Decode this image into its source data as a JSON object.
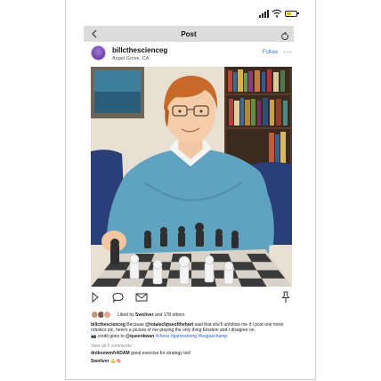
{
  "header": {
    "title": "Post"
  },
  "profile": {
    "username": "billcthescienceg",
    "location": "Angel Grove, CA",
    "follow_label": "Follow",
    "more_label": "···"
  },
  "photo": {
    "description_icon": "chess-player-photo"
  },
  "likes": {
    "prefix": "Liked by ",
    "user": "Swoliver",
    "suffix": " and 178 others"
  },
  "caption": {
    "author": "billcthescienceg",
    "part1": " Because ",
    "mention1": "@totaleclipseofthehart",
    "part2": " said that she'll unfollow me if I post one more robotics pic, here's a picture of me playing the only thing Einstein and I disagree on.",
    "camera": "📷",
    "part3": " credit goes to ",
    "mention2": "@queenkwan",
    "hashtags": " #chess #gamestrong #leaguechamp"
  },
  "view_all": "View all 2 comments",
  "comments": [
    {
      "user": "dntknowmfrADAM",
      "text": " great exercise for strategy too!"
    },
    {
      "user": "Swoliver",
      "text": " 💪🧠"
    }
  ],
  "colors": {
    "accent": "#3b74c8",
    "header_bg": "#dcdcdc",
    "battery": "#e6b800"
  }
}
